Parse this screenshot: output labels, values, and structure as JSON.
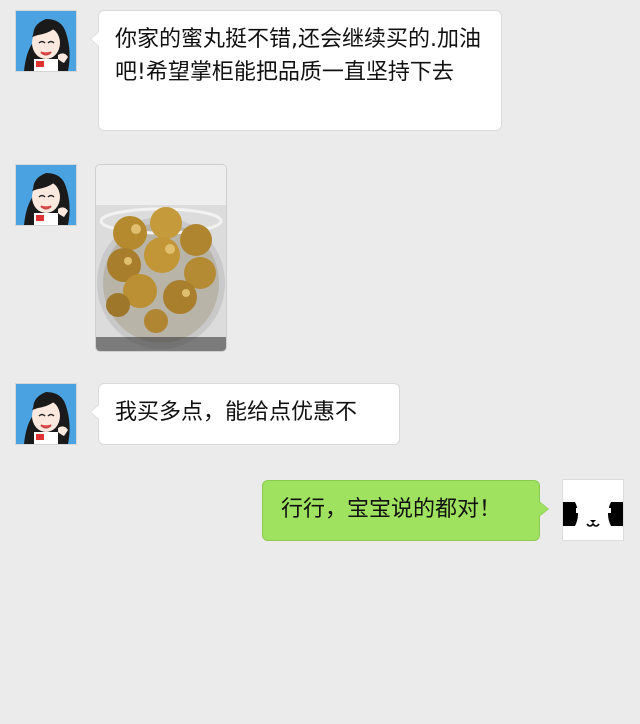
{
  "messages": [
    {
      "side": "left",
      "text": "你家的蜜丸挺不错,还会继续买的.加油吧!希望掌柜能把品质一直坚持下去"
    },
    {
      "side": "left",
      "type": "image",
      "image_desc": "jar-of-honey-pills"
    },
    {
      "side": "left",
      "text": "我买多点，能给点优惠不"
    },
    {
      "side": "right",
      "text": "行行，宝宝说的都对！"
    }
  ],
  "colors": {
    "background": "#ebebeb",
    "incoming_bubble": "#ffffff",
    "outgoing_bubble": "#9fe25f",
    "avatar_bg": "#4aa3e0"
  }
}
